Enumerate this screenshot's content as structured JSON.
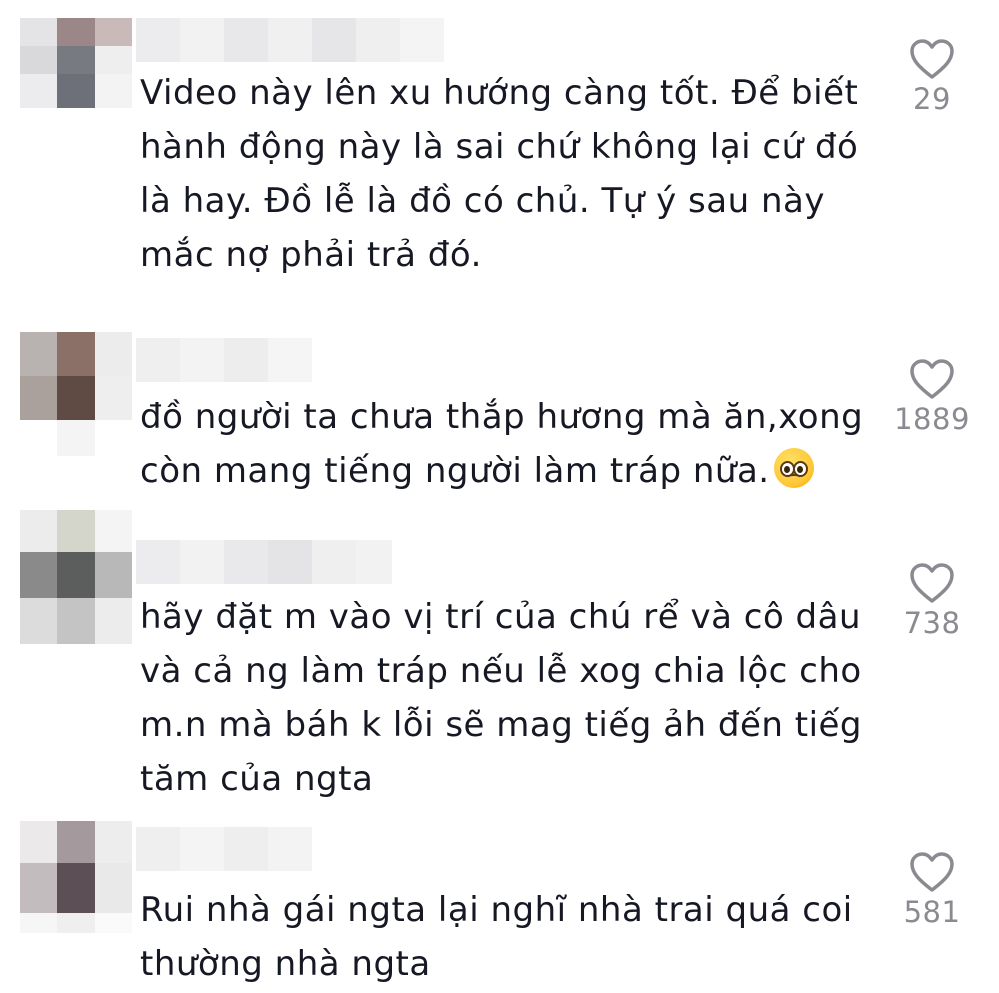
{
  "comments": [
    {
      "text": "Video này lên xu hướng càng tốt. Để biết\nhành động này là sai chứ không lại cứ đó\nlà hay. Đồ lễ là đồ có chủ. Tự ý sau này\nmắc nợ phải trả đó.",
      "likes": "29"
    },
    {
      "text": "đồ người ta chưa thắp hương mà ăn,xong\ncòn mang tiếng người làm tráp nữa.",
      "emoji": "pleading-face-emoji",
      "likes": "1889"
    },
    {
      "text": "hãy đặt m vào vị trí của chú rể và cô dâu\nvà cả ng làm tráp nếu lễ xog chia lộc cho\nm.n mà báh k lỗi sẽ mag tiếg ảh đến tiếg\ntăm của ngta",
      "likes": "738"
    },
    {
      "text": "Rui nhà gái ngta lại nghĩ nhà trai quá coi\nthường nhà ngta",
      "likes": "581"
    }
  ],
  "icons": {
    "like": "heart-outline-icon"
  },
  "colors": {
    "text": "#161823",
    "like_count": "#8a8b91",
    "heart_stroke": "#8a8b91"
  }
}
